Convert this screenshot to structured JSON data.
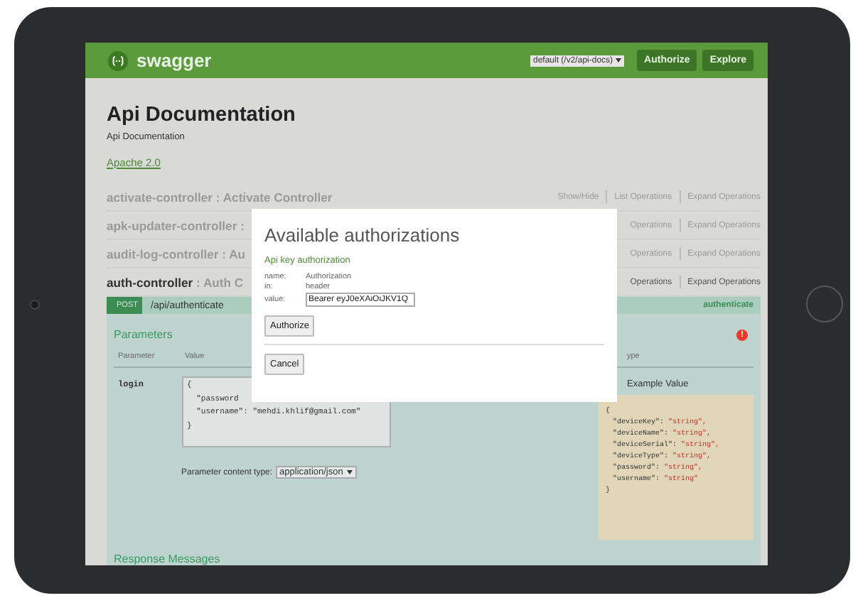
{
  "header": {
    "logo": "swagger",
    "api_select": "default (/v2/api-docs)",
    "buttons": [
      "Authorize",
      "Explore"
    ]
  },
  "info": {
    "title": "Api Documentation",
    "description": "Api Documentation",
    "license": "Apache 2.0"
  },
  "controllers": [
    {
      "name": "activate-controller",
      "description": " : Activate Controller",
      "active": false,
      "links": [
        "Show/Hide",
        "List Operations",
        "Expand Operations"
      ]
    },
    {
      "name": "apk-updater-controller",
      "description": " :",
      "active": false,
      "links": [
        "Operations",
        "Expand Operations"
      ]
    },
    {
      "name": "audit-log-controller",
      "description": " : Au",
      "active": false,
      "links": [
        "Operations",
        "Expand Operations"
      ]
    },
    {
      "name": "auth-controller",
      "description": " : Auth C",
      "active": true,
      "links": [
        "Operations",
        "Expand Operations"
      ]
    }
  ],
  "operation": {
    "method": "POST",
    "path": "/api/authenticate",
    "nickname": "authenticate",
    "parameters_title": "Parameters",
    "error_mark": "!",
    "columns": [
      "Parameter",
      "Value",
      "ype"
    ],
    "parameter": {
      "name": "login",
      "value_lines": [
        "{",
        "  \"password",
        "  \"username\": \"mehdi.khlif@gmail.com\"",
        "}"
      ]
    },
    "content_type_label": "Parameter content type:",
    "content_type": "application/json",
    "example_title": "Example Value",
    "example_open": "{",
    "example_fields": [
      {
        "key": "\"deviceKey\": ",
        "value": "\"string\","
      },
      {
        "key": "\"deviceName\": ",
        "value": "\"string\","
      },
      {
        "key": "\"deviceSerial\": ",
        "value": "\"string\","
      },
      {
        "key": "\"deviceType\": ",
        "value": "\"string\","
      },
      {
        "key": "\"password\": ",
        "value": "\"string\","
      },
      {
        "key": "\"username\": ",
        "value": "\"string\""
      }
    ],
    "example_close": "}",
    "responses_title": "Response Messages"
  },
  "modal": {
    "title": "Available authorizations",
    "section": "Api key authorization",
    "fields": [
      {
        "label": "name:",
        "value": "Authorization"
      },
      {
        "label": "in:",
        "value": "header"
      }
    ],
    "value_label": "value:",
    "value": "Bearer eyJ0eXAiOiJKV1Q",
    "buttons": [
      "Authorize",
      "Cancel"
    ]
  }
}
